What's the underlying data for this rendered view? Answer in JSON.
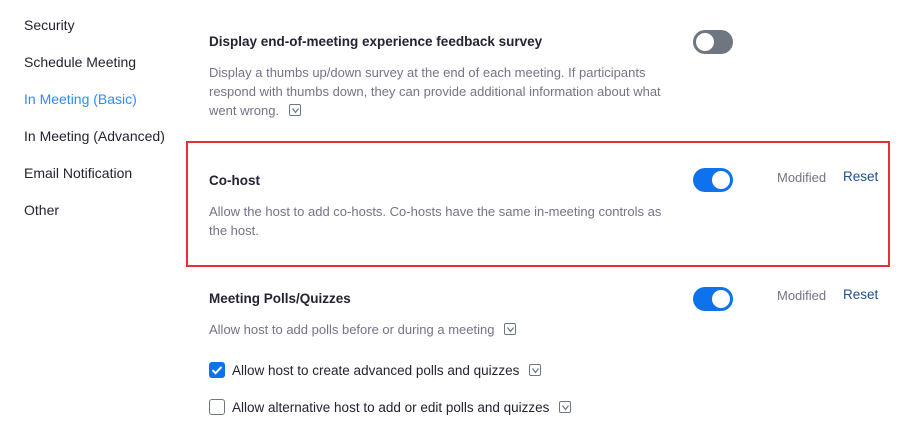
{
  "sidebar": {
    "items": [
      {
        "label": "Security"
      },
      {
        "label": "Schedule Meeting"
      },
      {
        "label": "In Meeting (Basic)",
        "active": true
      },
      {
        "label": "In Meeting (Advanced)"
      },
      {
        "label": "Email Notification"
      },
      {
        "label": "Other"
      }
    ]
  },
  "settings": {
    "feedback_survey": {
      "title": "Display end-of-meeting experience feedback survey",
      "description": "Display a thumbs up/down survey at the end of each meeting. If participants respond with thumbs down, they can provide additional information about what went wrong.",
      "enabled": false
    },
    "co_host": {
      "title": "Co-host",
      "description": "Allow the host to add co-hosts. Co-hosts have the same in-meeting controls as the host.",
      "enabled": true,
      "status": "Modified",
      "reset_label": "Reset"
    },
    "polls": {
      "title": "Meeting Polls/Quizzes",
      "description": "Allow host to add polls before or during a meeting",
      "enabled": true,
      "status": "Modified",
      "reset_label": "Reset",
      "options": [
        {
          "label": "Allow host to create advanced polls and quizzes",
          "checked": true
        },
        {
          "label": "Allow alternative host to add or edit polls and quizzes",
          "checked": false
        }
      ]
    }
  },
  "colors": {
    "accent": "#0e72ed",
    "active_nav": "#2d8cff",
    "highlight_border": "#e5303a",
    "toggle_off": "#6e7680"
  }
}
